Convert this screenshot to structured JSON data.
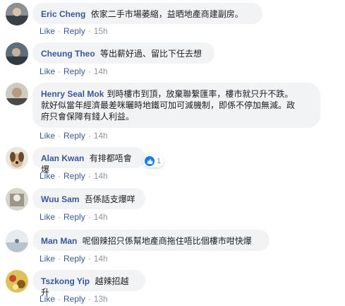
{
  "comments": [
    {
      "author": "Eric Cheng",
      "text": "依家二手市場萎縮，益晒地產商建副房。",
      "like": "Like",
      "reply": "Reply",
      "time": "15h"
    },
    {
      "author": "Cheung Theo",
      "text": "等出薪好過、留比下任去想",
      "like": "Like",
      "reply": "Reply",
      "time": "14h"
    },
    {
      "author": "Henry Seal Mok",
      "text_line1": "到時樓市到頂，放棄聯繫匯率，樓市就只升不跌。",
      "text_line2": "就好似當年經濟最差咪曬時地鐵可加可減機制，即係不停加無減。政",
      "text_line3": "府只會保障有錢人利益。",
      "like": "Like",
      "reply": "Reply",
      "time": "14h"
    },
    {
      "author": "Alan Kwan",
      "text": "有排都唔會爆",
      "like": "Like",
      "reply": "Reply",
      "time": "14h",
      "reaction_count": "1"
    },
    {
      "author": "Wuu Sam",
      "text": "吾係話支爆咩",
      "like": "Like",
      "reply": "Reply",
      "time": "14h"
    },
    {
      "author": "Man Man",
      "text": "呢個辣招只係幫地產商拖住唔比個樓市咁快爆",
      "like": "Like",
      "reply": "Reply",
      "time": "14h"
    },
    {
      "author": "Tszkong Yip",
      "text": "越辣招越升",
      "like": "Like",
      "reply": "Reply",
      "time": "13h"
    }
  ],
  "separator": "·",
  "colors": {
    "link": "#385898",
    "bubble": "#f2f3f5",
    "meta": "#90949c",
    "like_badge": "#1877f2"
  }
}
